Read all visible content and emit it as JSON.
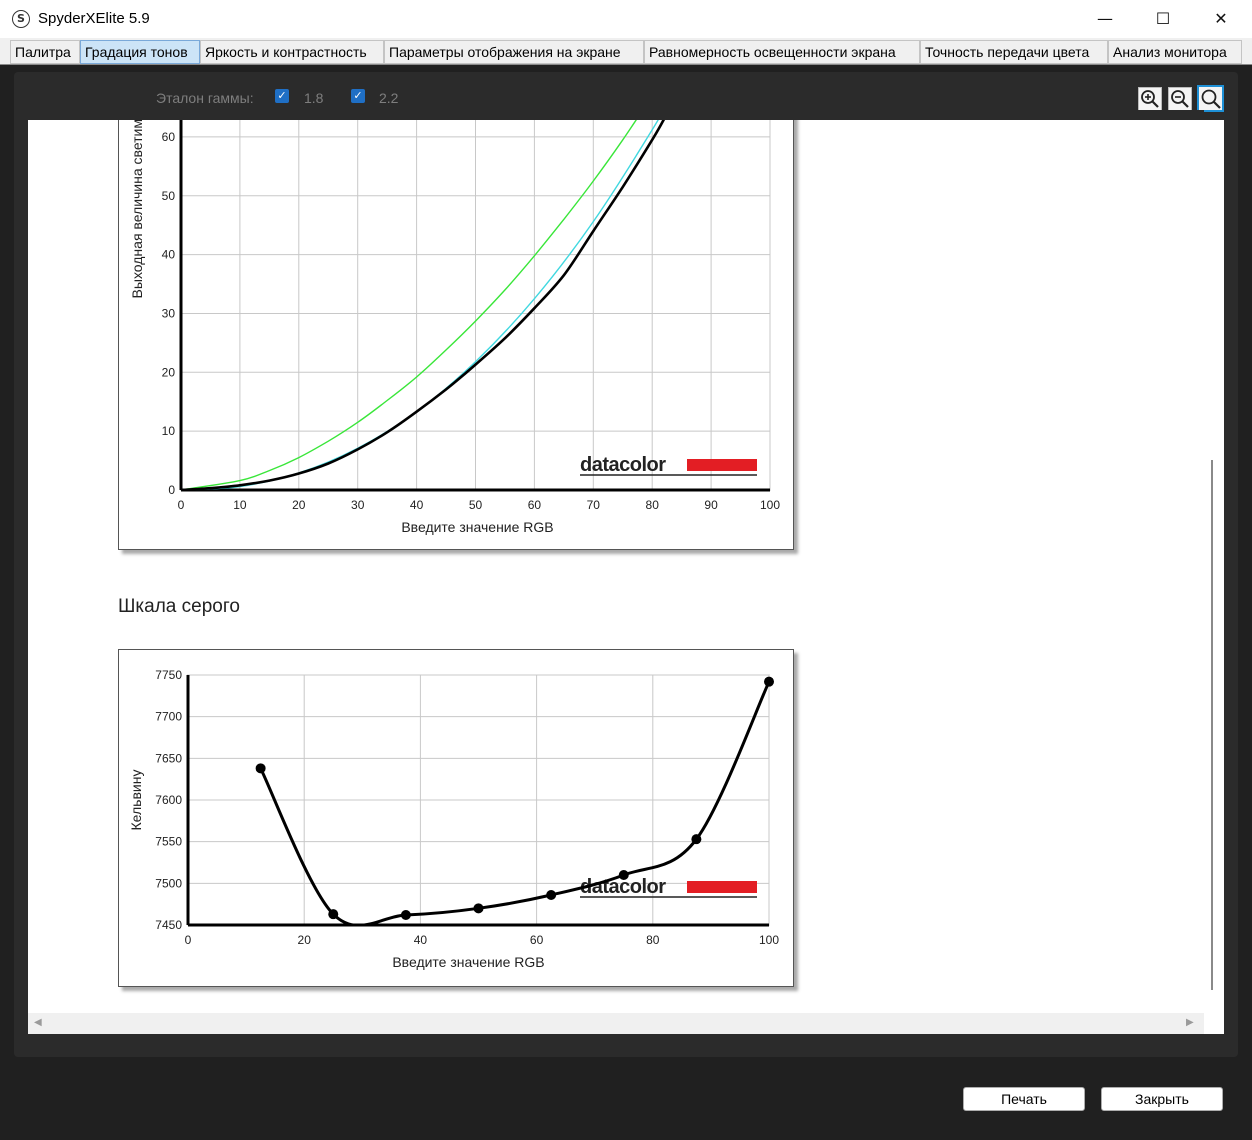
{
  "window": {
    "title": "SpyderXElite 5.9",
    "app_icon": "S",
    "minimize": "—",
    "maximize": "☐",
    "close": "✕"
  },
  "tabs": [
    {
      "label": "Палитра",
      "active": false
    },
    {
      "label": "Градация тонов",
      "active": true
    },
    {
      "label": "Яркость и контрастность",
      "active": false
    },
    {
      "label": "Параметры отображения на экране",
      "active": false
    },
    {
      "label": "Равномерность освещенности экрана",
      "active": false
    },
    {
      "label": "Точность передачи цвета",
      "active": false
    },
    {
      "label": "Анализ монитора",
      "active": false
    }
  ],
  "toolbar": {
    "gamma_label": "Эталон гаммы:",
    "gamma_1": {
      "label": "1.8",
      "checked": true
    },
    "gamma_2": {
      "label": "2.2",
      "checked": true
    },
    "zoom_in_icon": "zoom-in-icon",
    "zoom_out_icon": "zoom-out-icon",
    "zoom_fit_icon": "zoom-fit-icon"
  },
  "section_gray": {
    "title": "Шкала серого"
  },
  "buttons": {
    "print": "Печать",
    "close": "Закрыть"
  },
  "brand": {
    "logo_text": "datacolor",
    "logo_color": "#e31e24"
  },
  "chart_data": [
    {
      "type": "line",
      "title": "",
      "xlabel": "Введите значение RGB",
      "ylabel": "Выходная величина светим",
      "xlim": [
        0,
        100
      ],
      "ylim_visible": [
        0,
        63
      ],
      "x_ticks": [
        0,
        10,
        20,
        30,
        40,
        50,
        60,
        70,
        80,
        90,
        100
      ],
      "y_ticks": [
        0,
        10,
        20,
        30,
        40,
        50,
        60
      ],
      "grid": true,
      "series": [
        {
          "color": "#39e639",
          "x": [
            0,
            10,
            15,
            20,
            25,
            30,
            35,
            40,
            45,
            50,
            55,
            60,
            65,
            70,
            75,
            80,
            82
          ],
          "y": [
            0,
            1.6,
            3.3,
            5.5,
            8.3,
            11.5,
            15.2,
            19.2,
            23.8,
            28.7,
            34.0,
            39.8,
            46.0,
            52.5,
            59.5,
            67.0,
            70.0
          ]
        },
        {
          "color": "#40d8e0",
          "x": [
            0,
            10,
            20,
            30,
            40,
            50,
            60,
            70,
            80,
            85
          ],
          "y": [
            0,
            0.6,
            2.9,
            7.1,
            13.3,
            21.8,
            32.5,
            45.6,
            61.2,
            70.0
          ]
        },
        {
          "color": "#000000",
          "x": [
            0,
            5,
            10,
            15,
            20,
            25,
            30,
            35,
            40,
            45,
            50,
            55,
            60,
            65,
            70,
            75,
            80,
            82
          ],
          "y": [
            0,
            0.3,
            0.8,
            1.6,
            2.8,
            4.5,
            6.9,
            9.8,
            13.3,
            17.1,
            21.3,
            25.8,
            30.9,
            36.5,
            44.0,
            51.5,
            59.5,
            63.0
          ]
        }
      ]
    },
    {
      "type": "line",
      "title": "",
      "xlabel": "Введите значение RGB",
      "ylabel": "Кельвину",
      "xlim": [
        0,
        100
      ],
      "ylim": [
        7450,
        7750
      ],
      "x_ticks": [
        0,
        20,
        40,
        60,
        80,
        100
      ],
      "y_ticks": [
        7450,
        7500,
        7550,
        7600,
        7650,
        7700,
        7750
      ],
      "grid": true,
      "series": [
        {
          "color": "#000000",
          "markers": true,
          "x": [
            12.5,
            25,
            37.5,
            50,
            62.5,
            75,
            87.5,
            100
          ],
          "y": [
            7638,
            7463,
            7462,
            7470,
            7486,
            7510,
            7553,
            7742
          ]
        }
      ]
    }
  ]
}
